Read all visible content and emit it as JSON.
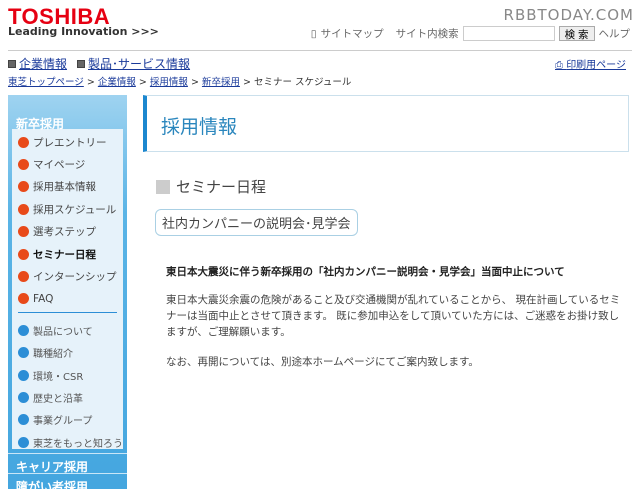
{
  "header": {
    "logo": "TOSHIBA",
    "tagline": "Leading Innovation >>>",
    "watermark": "RBBTODAY.COM",
    "sitemap": "サイトマップ",
    "search_label": "サイト内検索",
    "search_value": "",
    "search_button": "検 索",
    "help": "ヘルプ"
  },
  "global_nav": {
    "items": [
      "企業情報",
      "製品･サービス情報"
    ],
    "print": "印刷用ページ"
  },
  "breadcrumb": {
    "items": [
      "東芝トップページ",
      "企業情報",
      "採用情報",
      "新卒採用"
    ],
    "current": "セミナー スケジュール",
    "sep": ">"
  },
  "sidebar": {
    "heading": "新卒採用",
    "items": [
      {
        "label": "プレエントリー"
      },
      {
        "label": "マイページ"
      },
      {
        "label": "採用基本情報"
      },
      {
        "label": "採用スケジュール"
      },
      {
        "label": "選考ステップ"
      },
      {
        "label": "セミナー日程"
      },
      {
        "label": "インターンシップ"
      },
      {
        "label": "FAQ"
      }
    ],
    "sub_items": [
      {
        "label": "製品について"
      },
      {
        "label": "職種紹介"
      },
      {
        "label": "環境・CSR"
      },
      {
        "label": "歴史と沿革"
      },
      {
        "label": "事業グループ"
      },
      {
        "label": "東芝をもっと知ろう"
      }
    ],
    "sections": [
      "キャリア採用",
      "障がい者採用"
    ]
  },
  "main": {
    "title": "採用情報",
    "heading": "セミナー日程",
    "tag": "社内カンパニーの説明会･見学会",
    "notice_title": "東日本大震災に伴う新卒採用の「社内カンパニー説明会・見学会」当面中止について",
    "paragraph1": "東日本大震災余震の危険があること及び交通機関が乱れていることから、 現在計画しているセミナーは当面中止とさせて頂きます。 既に参加申込をして頂いていた方には、ご迷惑をお掛け致しますが、ご理解願います。",
    "paragraph2": "なお、再開については、別途本ホームページにてご案内致します。"
  }
}
